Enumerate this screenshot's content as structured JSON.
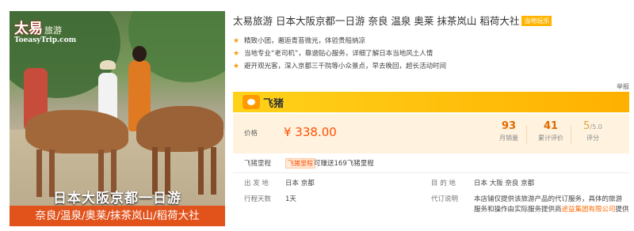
{
  "image": {
    "logo_cn": "太易",
    "logo_cn2": "旅游",
    "logo_url": "ToeasyTrip.com",
    "title": "日本大阪京都一日游",
    "subtitle": "奈良/温泉/奥莱/抹茶岚山/稻荷大社"
  },
  "product": {
    "title": "太易旅游 日本大阪京都一日游 奈良 温泉 奥莱 抹茶岚山 稻荷大社",
    "badge": "当地玩乐",
    "features": [
      "精致小团，邂逅青苔微光，体验贵船纳凉",
      "当地专业“老司机”，靠谱贴心服务，详细了解日本当地风土人情",
      "避开观光客，深入京都三千院等小众景点，早去晚回，超长活动时间"
    ],
    "report_label": "举报"
  },
  "brand": {
    "name": "飞猪",
    "color": "#ffb000"
  },
  "pricing": {
    "price_label": "价格",
    "price": "¥ 338.00",
    "monthly_sales": "93",
    "monthly_sales_label": "月销量",
    "reviews": "41",
    "reviews_label": "累计评价",
    "score": "5",
    "score_max": "/5.0",
    "score_label": "评分"
  },
  "miles": {
    "label": "飞猪里程",
    "tag": "飞猪里程",
    "text": "可赚送169飞猪里程"
  },
  "details": {
    "departure_label": "出 发 地",
    "departure_value": "日本  京都",
    "destination_label": "目 的 地",
    "destination_value": "日本  大阪  奈良  京都",
    "days_label": "行程天数",
    "days_value": "1天",
    "agency_label": "代订说明",
    "agency_line1": "本店铺仅提供该旅游产品的代订服务，具体的旅游",
    "agency_line2_pre": "服务和操作由实际服务提供商",
    "agency_link": "途益集团有限公司",
    "agency_line2_post": "提供"
  }
}
